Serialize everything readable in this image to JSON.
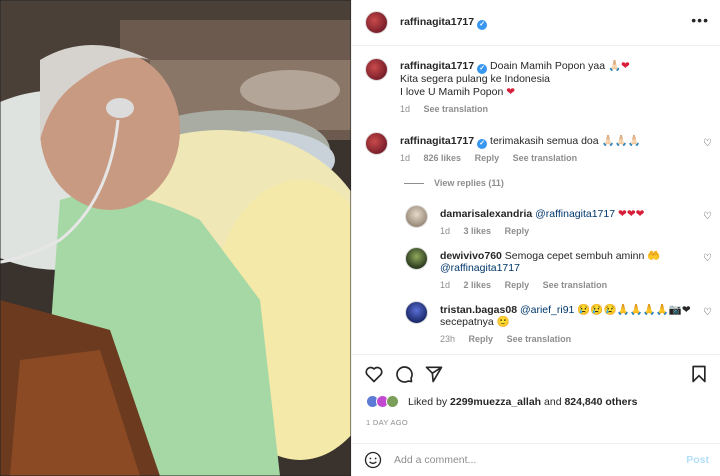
{
  "post": {
    "author": "raffinagita1717",
    "author_verified": true,
    "more_icon": "more-options-icon",
    "caption": {
      "author": "raffinagita1717",
      "line1": "Doain Mamih Popon yaa",
      "line1_emoji": "🙏🏻❤",
      "line2": "Kita segera pulang ke Indonesia",
      "line3": "I love U Mamih Popon",
      "line3_emoji": "❤",
      "age": "1d",
      "see_translation": "See translation"
    }
  },
  "comments": [
    {
      "author": "raffinagita1717",
      "text": "terimakasih semua doa",
      "emoji": "🙏🏻🙏🏻🙏🏻",
      "age": "1d",
      "likes": "826 likes",
      "reply": "Reply",
      "see_translation": "See translation",
      "view_replies": "View replies (11)"
    }
  ],
  "replies": [
    {
      "author": "damarisalexandria",
      "mention": "@raffinagita1717",
      "emoji": "❤❤❤",
      "age": "1d",
      "likes": "3 likes",
      "reply": "Reply"
    },
    {
      "author": "dewivivo760",
      "text": "Semoga cepet sembuh aminn",
      "emoji": "🤲",
      "mention": "@raffinagita1717",
      "age": "1d",
      "likes": "2 likes",
      "reply": "Reply",
      "see_translation": "See translation"
    },
    {
      "author": "tristan.bagas08",
      "mention": "@arief_ri91",
      "emoji": "😢😢😢🙏🙏🙏🙏📷❤",
      "line2": "secepatnya",
      "line2_emoji": "🙂",
      "age": "23h",
      "reply": "Reply",
      "see_translation": "See translation"
    }
  ],
  "actions": {
    "like_icon": "heart-icon",
    "comment_icon": "comment-icon",
    "share_icon": "share-icon",
    "save_icon": "bookmark-icon"
  },
  "likes": {
    "prefix": "Liked by",
    "user": "2299muezza_allah",
    "and": "and",
    "others": "824,840 others"
  },
  "date": "1 DAY AGO",
  "add_comment": {
    "placeholder": "Add a comment...",
    "post_label": "Post"
  }
}
